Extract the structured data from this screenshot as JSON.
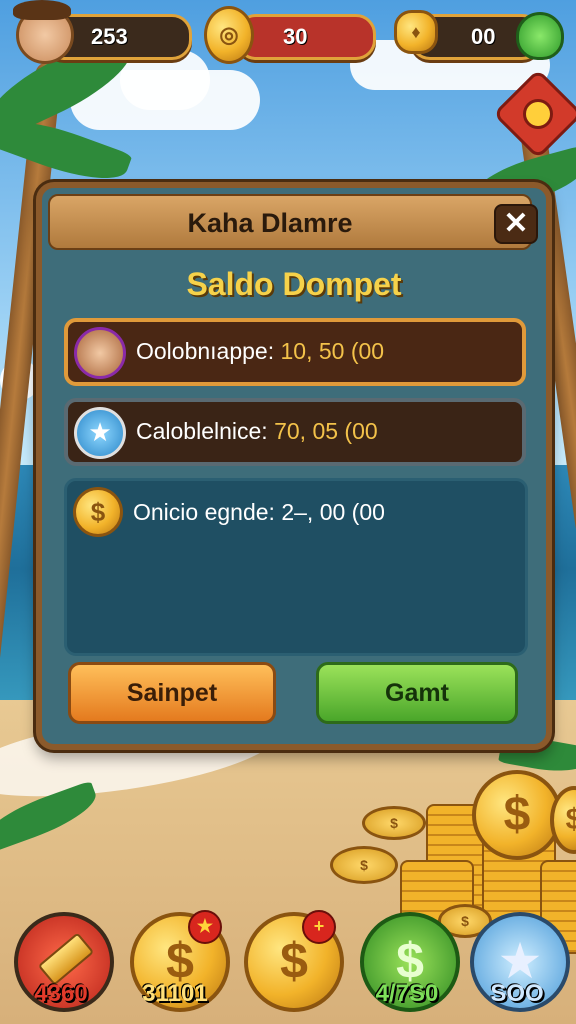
{
  "hud": {
    "player_count": "253",
    "energy": "30",
    "potions": "00"
  },
  "panel": {
    "title": "Kaha Dlamre",
    "close_label": "✕",
    "subtitle": "Saldo Dompet",
    "rows": [
      {
        "label": "Oolobnıappe:",
        "amount": "10, 50 (00"
      },
      {
        "label": "Caloblelnice:",
        "amount": "70, 05 (00"
      },
      {
        "label": "Onicio egnde:",
        "amount": "2–, 00 (00"
      }
    ],
    "buttons": {
      "left": "Sainpet",
      "right": "Gamt"
    }
  },
  "bottom_bar": [
    {
      "icon": "gold-bar-icon",
      "value": "4360",
      "color": "#e23a2a"
    },
    {
      "icon": "coin-star-icon",
      "value": "31101",
      "color": "#ffe07a"
    },
    {
      "icon": "coin-plus-icon",
      "value": "",
      "color": "#ffe07a"
    },
    {
      "icon": "green-coin-icon",
      "value": "4/7S0",
      "color": "#7ee05a"
    },
    {
      "icon": "star-badge-icon",
      "value": "SOO",
      "color": "#cfe8ff"
    }
  ],
  "colors": {
    "panel_bg": "#3e6d7a",
    "accent_gold": "#f6d24a",
    "wood": "#8b5a2b"
  }
}
